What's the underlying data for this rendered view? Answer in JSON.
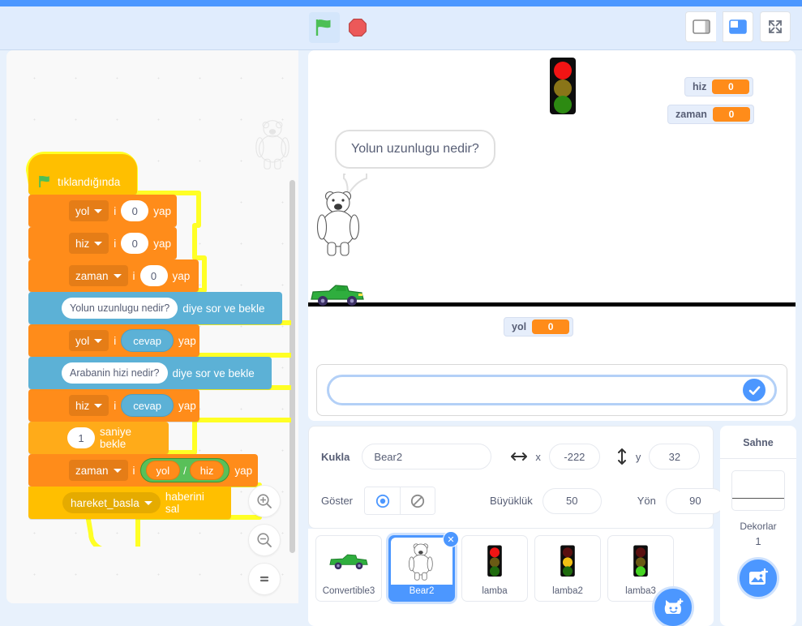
{
  "app": {
    "bg_color": "#e8f1fc",
    "accent": "#4c97ff"
  },
  "toolbar": {
    "green_flag_icon": "green-flag-icon",
    "stop_icon": "stop-sign-icon",
    "layout_small_icon": "layout-small-stage-icon",
    "layout_large_icon": "layout-large-stage-icon",
    "fullscreen_icon": "fullscreen-icon"
  },
  "code_area": {
    "zoom_in_label": "zoom-in",
    "zoom_out_label": "zoom-out",
    "zoom_reset_label": "zoom-reset",
    "watermark": "bear-watermark"
  },
  "script": {
    "hat": {
      "label": "tıklandığında",
      "icon": "green-flag-icon"
    },
    "blocks": [
      {
        "type": "data",
        "var": "yol",
        "mid": "i",
        "value": "0",
        "tail": "yap"
      },
      {
        "type": "data",
        "var": "hiz",
        "mid": "i",
        "value": "0",
        "tail": "yap"
      },
      {
        "type": "data",
        "var": "zaman",
        "mid": "i",
        "value": "0",
        "tail": "yap"
      },
      {
        "type": "sense",
        "question": "Yolun uzunlugu nedir?",
        "tail": "diye sor ve bekle"
      },
      {
        "type": "data_reporter",
        "var": "yol",
        "mid": "i",
        "reporter": "cevap",
        "tail": "yap"
      },
      {
        "type": "sense",
        "question": "Arabanin hizi nedir?",
        "tail": "diye sor ve bekle"
      },
      {
        "type": "data_reporter",
        "var": "hiz",
        "mid": "i",
        "reporter": "cevap",
        "tail": "yap"
      },
      {
        "type": "control",
        "value": "1",
        "tail": "saniye bekle"
      },
      {
        "type": "data_division",
        "var": "zaman",
        "mid": "i",
        "left": "yol",
        "operator": "/",
        "right": "hiz",
        "tail": "yap"
      },
      {
        "type": "event",
        "message": "hareket_basla",
        "tail": "haberini sal"
      }
    ]
  },
  "stage": {
    "monitors": [
      {
        "name": "hiz",
        "value": "0"
      },
      {
        "name": "zaman",
        "value": "0"
      },
      {
        "name": "yol",
        "value": "0"
      }
    ],
    "speech_bubble": "Yolun uzunlugu nedir?",
    "sprites_on_stage": [
      "bear-sprite",
      "traffic-light-sprite",
      "green-convertible-sprite"
    ],
    "ask_input_value": "",
    "ask_input_placeholder": "",
    "ask_submit_icon": "check-icon"
  },
  "sprite_info": {
    "sprite_label": "Kukla",
    "sprite_name": "Bear2",
    "x_label": "x",
    "x_value": "-222",
    "y_label": "y",
    "y_value": "32",
    "show_label": "Göster",
    "show_icon": "eye-visible-icon",
    "hide_icon": "eye-hidden-icon",
    "size_label": "Büyüklük",
    "size_value": "50",
    "direction_label": "Yön",
    "direction_value": "90"
  },
  "sprite_list": {
    "add_sprite_icon": "add-sprite-cat-icon",
    "items": [
      {
        "name": "Convertible3",
        "thumb": "green-convertible-icon",
        "selected": false
      },
      {
        "name": "Bear2",
        "thumb": "bear-icon",
        "selected": true
      },
      {
        "name": "lamba",
        "thumb": "traffic-light-red-icon",
        "selected": false
      },
      {
        "name": "lamba2",
        "thumb": "traffic-light-yellow-icon",
        "selected": false
      },
      {
        "name": "lamba3",
        "thumb": "traffic-light-green-icon",
        "selected": false
      }
    ]
  },
  "stage_selector": {
    "title": "Sahne",
    "backdrops_label": "Dekorlar",
    "backdrops_count": "1",
    "add_backdrop_icon": "add-backdrop-image-icon"
  }
}
